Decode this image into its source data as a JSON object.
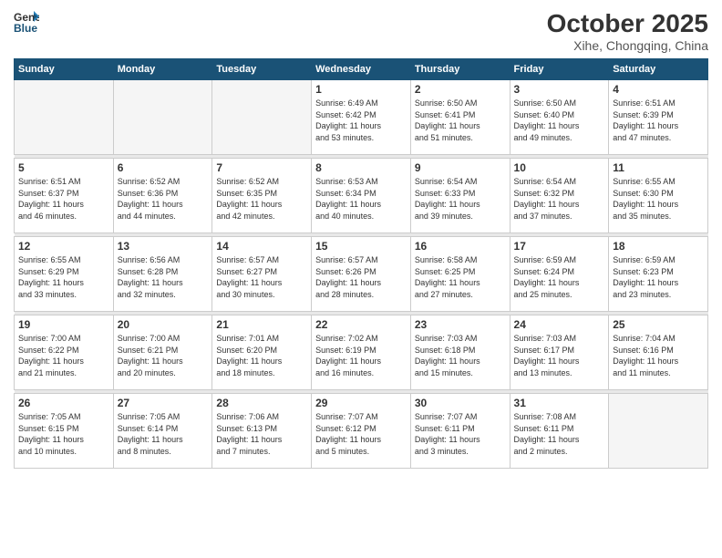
{
  "header": {
    "logo_general": "General",
    "logo_blue": "Blue",
    "month_title": "October 2025",
    "subtitle": "Xihe, Chongqing, China"
  },
  "weekdays": [
    "Sunday",
    "Monday",
    "Tuesday",
    "Wednesday",
    "Thursday",
    "Friday",
    "Saturday"
  ],
  "weeks": [
    [
      {
        "day": "",
        "info": ""
      },
      {
        "day": "",
        "info": ""
      },
      {
        "day": "",
        "info": ""
      },
      {
        "day": "1",
        "info": "Sunrise: 6:49 AM\nSunset: 6:42 PM\nDaylight: 11 hours\nand 53 minutes."
      },
      {
        "day": "2",
        "info": "Sunrise: 6:50 AM\nSunset: 6:41 PM\nDaylight: 11 hours\nand 51 minutes."
      },
      {
        "day": "3",
        "info": "Sunrise: 6:50 AM\nSunset: 6:40 PM\nDaylight: 11 hours\nand 49 minutes."
      },
      {
        "day": "4",
        "info": "Sunrise: 6:51 AM\nSunset: 6:39 PM\nDaylight: 11 hours\nand 47 minutes."
      }
    ],
    [
      {
        "day": "5",
        "info": "Sunrise: 6:51 AM\nSunset: 6:37 PM\nDaylight: 11 hours\nand 46 minutes."
      },
      {
        "day": "6",
        "info": "Sunrise: 6:52 AM\nSunset: 6:36 PM\nDaylight: 11 hours\nand 44 minutes."
      },
      {
        "day": "7",
        "info": "Sunrise: 6:52 AM\nSunset: 6:35 PM\nDaylight: 11 hours\nand 42 minutes."
      },
      {
        "day": "8",
        "info": "Sunrise: 6:53 AM\nSunset: 6:34 PM\nDaylight: 11 hours\nand 40 minutes."
      },
      {
        "day": "9",
        "info": "Sunrise: 6:54 AM\nSunset: 6:33 PM\nDaylight: 11 hours\nand 39 minutes."
      },
      {
        "day": "10",
        "info": "Sunrise: 6:54 AM\nSunset: 6:32 PM\nDaylight: 11 hours\nand 37 minutes."
      },
      {
        "day": "11",
        "info": "Sunrise: 6:55 AM\nSunset: 6:30 PM\nDaylight: 11 hours\nand 35 minutes."
      }
    ],
    [
      {
        "day": "12",
        "info": "Sunrise: 6:55 AM\nSunset: 6:29 PM\nDaylight: 11 hours\nand 33 minutes."
      },
      {
        "day": "13",
        "info": "Sunrise: 6:56 AM\nSunset: 6:28 PM\nDaylight: 11 hours\nand 32 minutes."
      },
      {
        "day": "14",
        "info": "Sunrise: 6:57 AM\nSunset: 6:27 PM\nDaylight: 11 hours\nand 30 minutes."
      },
      {
        "day": "15",
        "info": "Sunrise: 6:57 AM\nSunset: 6:26 PM\nDaylight: 11 hours\nand 28 minutes."
      },
      {
        "day": "16",
        "info": "Sunrise: 6:58 AM\nSunset: 6:25 PM\nDaylight: 11 hours\nand 27 minutes."
      },
      {
        "day": "17",
        "info": "Sunrise: 6:59 AM\nSunset: 6:24 PM\nDaylight: 11 hours\nand 25 minutes."
      },
      {
        "day": "18",
        "info": "Sunrise: 6:59 AM\nSunset: 6:23 PM\nDaylight: 11 hours\nand 23 minutes."
      }
    ],
    [
      {
        "day": "19",
        "info": "Sunrise: 7:00 AM\nSunset: 6:22 PM\nDaylight: 11 hours\nand 21 minutes."
      },
      {
        "day": "20",
        "info": "Sunrise: 7:00 AM\nSunset: 6:21 PM\nDaylight: 11 hours\nand 20 minutes."
      },
      {
        "day": "21",
        "info": "Sunrise: 7:01 AM\nSunset: 6:20 PM\nDaylight: 11 hours\nand 18 minutes."
      },
      {
        "day": "22",
        "info": "Sunrise: 7:02 AM\nSunset: 6:19 PM\nDaylight: 11 hours\nand 16 minutes."
      },
      {
        "day": "23",
        "info": "Sunrise: 7:03 AM\nSunset: 6:18 PM\nDaylight: 11 hours\nand 15 minutes."
      },
      {
        "day": "24",
        "info": "Sunrise: 7:03 AM\nSunset: 6:17 PM\nDaylight: 11 hours\nand 13 minutes."
      },
      {
        "day": "25",
        "info": "Sunrise: 7:04 AM\nSunset: 6:16 PM\nDaylight: 11 hours\nand 11 minutes."
      }
    ],
    [
      {
        "day": "26",
        "info": "Sunrise: 7:05 AM\nSunset: 6:15 PM\nDaylight: 11 hours\nand 10 minutes."
      },
      {
        "day": "27",
        "info": "Sunrise: 7:05 AM\nSunset: 6:14 PM\nDaylight: 11 hours\nand 8 minutes."
      },
      {
        "day": "28",
        "info": "Sunrise: 7:06 AM\nSunset: 6:13 PM\nDaylight: 11 hours\nand 7 minutes."
      },
      {
        "day": "29",
        "info": "Sunrise: 7:07 AM\nSunset: 6:12 PM\nDaylight: 11 hours\nand 5 minutes."
      },
      {
        "day": "30",
        "info": "Sunrise: 7:07 AM\nSunset: 6:11 PM\nDaylight: 11 hours\nand 3 minutes."
      },
      {
        "day": "31",
        "info": "Sunrise: 7:08 AM\nSunset: 6:11 PM\nDaylight: 11 hours\nand 2 minutes."
      },
      {
        "day": "",
        "info": ""
      }
    ]
  ]
}
